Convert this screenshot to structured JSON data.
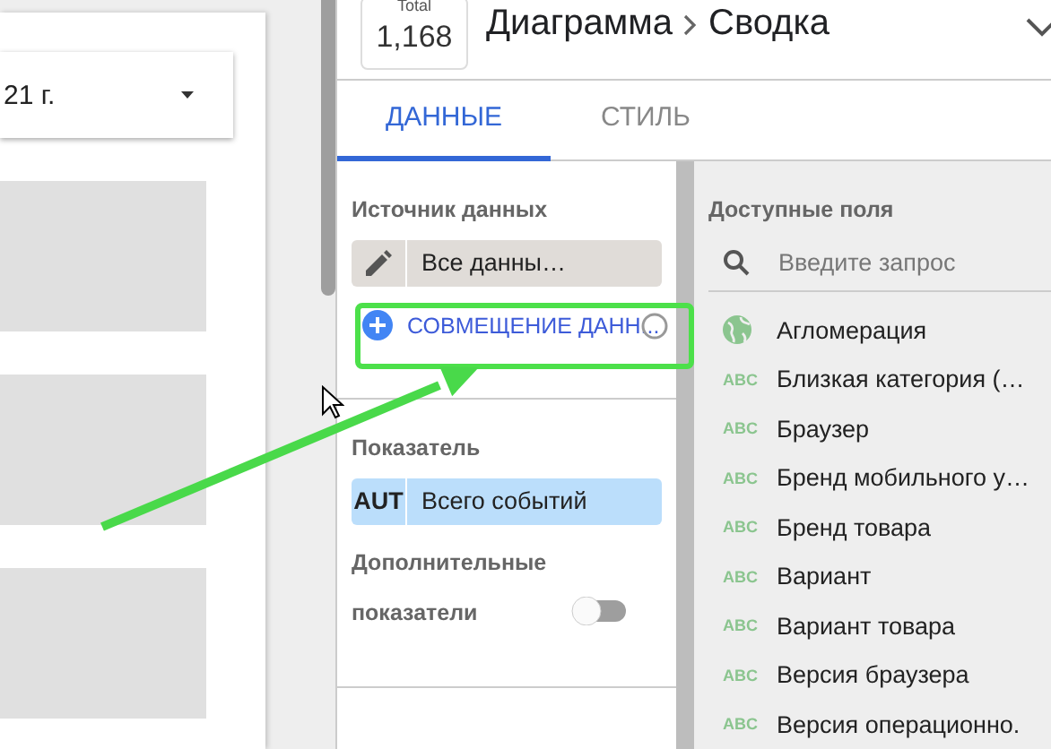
{
  "canvas": {
    "date_dropdown": {
      "value": "21 г."
    },
    "blocks": [
      {
        "kind": "placeholder"
      },
      {
        "kind": "placeholder"
      },
      {
        "kind": "placeholder"
      }
    ]
  },
  "header": {
    "total_label": "Total",
    "total_value": "1,168",
    "breadcrumb": [
      "Диаграмма",
      "Сводка"
    ]
  },
  "tabs": [
    {
      "label": "ДАННЫЕ",
      "selected": true
    },
    {
      "label": "СТИЛЬ",
      "selected": false
    }
  ],
  "setup": {
    "data_source_label": "Источник данных",
    "data_source": "Все данны…",
    "blend_button": "СОВМЕЩЕНИЕ ДАНН...",
    "metric_label": "Показатель",
    "metric": {
      "type": "AUT",
      "name": "Всего событий"
    },
    "optional_metrics_label": [
      "Дополнительные",
      "показатели"
    ],
    "optional_metrics_on": false
  },
  "fields": {
    "label": "Доступные поля",
    "search": {
      "placeholder": "Введите запрос"
    },
    "items": [
      {
        "kind": "geo",
        "name": "Агломерация"
      },
      {
        "kind": "text",
        "type": "ABC",
        "name": "Близкая категория (…"
      },
      {
        "kind": "text",
        "type": "ABC",
        "name": "Браузер"
      },
      {
        "kind": "text",
        "type": "ABC",
        "name": "Бренд мобильного у…"
      },
      {
        "kind": "text",
        "type": "ABC",
        "name": "Бренд товара"
      },
      {
        "kind": "text",
        "type": "ABC",
        "name": "Вариант"
      },
      {
        "kind": "text",
        "type": "ABC",
        "name": "Вариант товара"
      },
      {
        "kind": "text",
        "type": "ABC",
        "name": "Версия браузера"
      },
      {
        "kind": "text",
        "type": "ABC",
        "name": "Версия операционно."
      }
    ]
  }
}
